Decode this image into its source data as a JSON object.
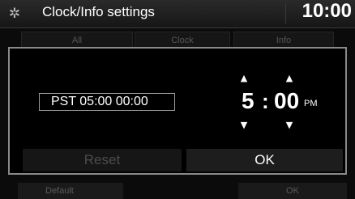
{
  "header": {
    "title": "Clock/Info settings",
    "clock": "10:00",
    "icon": "gear-icon"
  },
  "background_tabs": [
    "All",
    "Clock",
    "Info"
  ],
  "background_buttons": [
    "Default",
    "OK"
  ],
  "dialog": {
    "timezone_display": "PST 05:00   00:00",
    "hour": "5",
    "separator": ":",
    "minute": "00",
    "ampm": "PM",
    "reset_label": "Reset",
    "ok_label": "OK"
  },
  "colors": {
    "background": "#0b0b0b",
    "dialog_border": "#8a8a8a",
    "disabled_text": "#4c4c4c"
  }
}
